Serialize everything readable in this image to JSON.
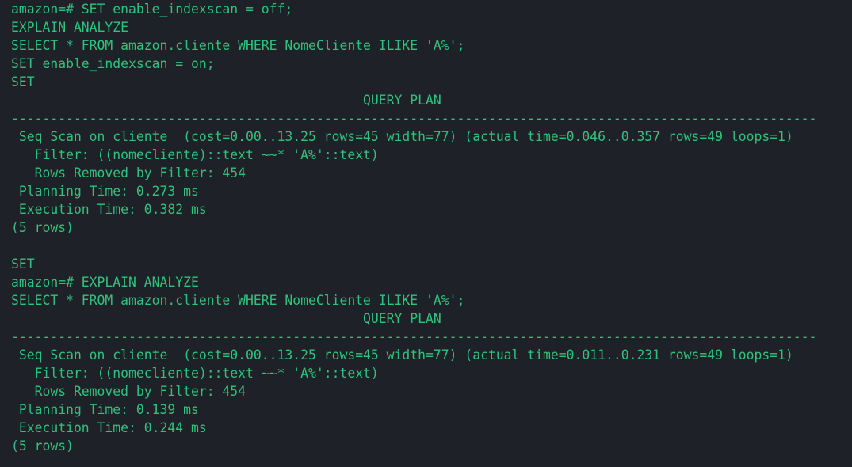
{
  "terminal": {
    "lines": [
      "amazon=# SET enable_indexscan = off;",
      "EXPLAIN ANALYZE",
      "SELECT * FROM amazon.cliente WHERE NomeCliente ILIKE 'A%';",
      "SET enable_indexscan = on;",
      "SET",
      "                                             QUERY PLAN",
      "-------------------------------------------------------------------------------------------------------",
      " Seq Scan on cliente  (cost=0.00..13.25 rows=45 width=77) (actual time=0.046..0.357 rows=49 loops=1)",
      "   Filter: ((nomecliente)::text ~~* 'A%'::text)",
      "   Rows Removed by Filter: 454",
      " Planning Time: 0.273 ms",
      " Execution Time: 0.382 ms",
      "(5 rows)",
      "",
      "SET",
      "amazon=# EXPLAIN ANALYZE",
      "SELECT * FROM amazon.cliente WHERE NomeCliente ILIKE 'A%';",
      "                                             QUERY PLAN",
      "-------------------------------------------------------------------------------------------------------",
      " Seq Scan on cliente  (cost=0.00..13.25 rows=45 width=77) (actual time=0.011..0.231 rows=49 loops=1)",
      "   Filter: ((nomecliente)::text ~~* 'A%'::text)",
      "   Rows Removed by Filter: 454",
      " Planning Time: 0.139 ms",
      " Execution Time: 0.244 ms",
      "(5 rows)"
    ]
  },
  "colors": {
    "background": "#1e2128",
    "text": "#2fc27a"
  }
}
